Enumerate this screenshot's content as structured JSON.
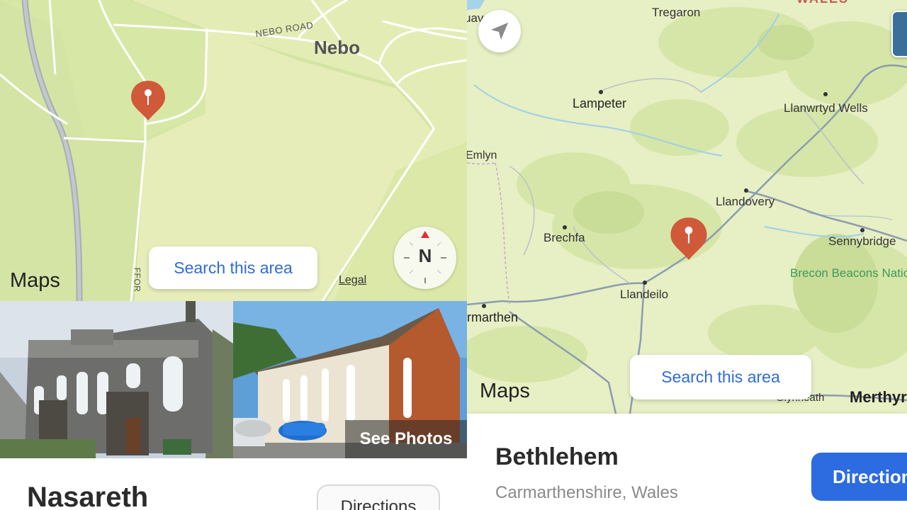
{
  "left_panel": {
    "map": {
      "labels": {
        "town": "Nebo",
        "road": "NEBO ROAD",
        "vertical_road": "FFOR"
      },
      "search_button": "Search this area",
      "maps_logo": "Maps",
      "legal": "Legal",
      "compass_letter": "N",
      "pin_color": "#d0593a"
    },
    "photos": {
      "see_photos": "See Photos"
    },
    "place": {
      "title": "Nasareth",
      "directions_label": "Directions"
    }
  },
  "right_panel": {
    "map": {
      "labels": {
        "tregaron": "Tregaron",
        "wales": "WALES",
        "uav": "uav",
        "lampeter": "Lampeter",
        "llanwrtyd": "Llanwrtyd Wells",
        "emlyn": "Emlyn",
        "llandovery": "Llandovery",
        "brechfa": "Brechfa",
        "sennybridge": "Sennybridge",
        "park": "Brecon Beacons National Park",
        "llandeilo": "Llandeilo",
        "carmarthen": "rmarthen",
        "glynneath": "Glynneath",
        "merthyr": "Merthyr"
      },
      "search_button": "Search this area",
      "maps_logo": "Maps",
      "pin_color": "#d0593a"
    },
    "place": {
      "title": "Bethlehem",
      "subtitle": "Carmarthenshire, Wales",
      "directions_label": "Directions"
    }
  },
  "colors": {
    "accent_blue": "#2f6bd8",
    "directions_blue": "#2c6be0",
    "map_green": "#dde8a9",
    "park_green": "#3f9a5c"
  }
}
